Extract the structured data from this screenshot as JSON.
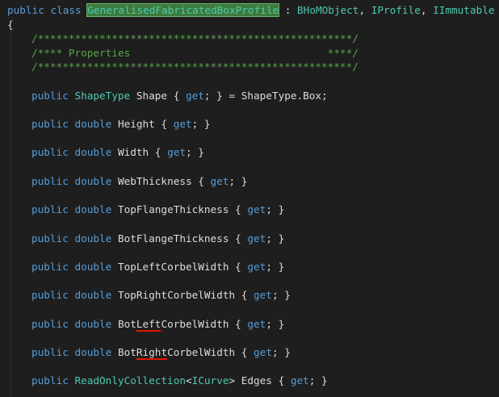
{
  "class_decl": {
    "public": "public",
    "class": "class",
    "name": "GeneralisedFabricatedBoxProfile",
    "colon": " : ",
    "base1": "BHoMObject",
    "comma1": ", ",
    "base2": "IProfile",
    "comma2": ", ",
    "base3": "IImmutable"
  },
  "open_brace": "{",
  "comments": {
    "line1": "/***************************************************/",
    "line2": "/**** Properties                                ****/",
    "line3": "/***************************************************/"
  },
  "properties": [
    {
      "mod": "public",
      "type": "ShapeType",
      "name": " Shape { ",
      "get": "get",
      "tail": "; } = ShapeType.Box;"
    },
    {
      "mod": "public",
      "type": "double",
      "name": " Height { ",
      "get": "get",
      "tail": "; }"
    },
    {
      "mod": "public",
      "type": "double",
      "name": " Width { ",
      "get": "get",
      "tail": "; }"
    },
    {
      "mod": "public",
      "type": "double",
      "name": " WebThickness { ",
      "get": "get",
      "tail": "; }"
    },
    {
      "mod": "public",
      "type": "double",
      "name": " TopFlangeThickness { ",
      "get": "get",
      "tail": "; }"
    },
    {
      "mod": "public",
      "type": "double",
      "name": " BotFlangeThickness { ",
      "get": "get",
      "tail": "; }"
    },
    {
      "mod": "public",
      "type": "double",
      "name": " TopLeftCorbelWidth { ",
      "get": "get",
      "tail": "; }"
    },
    {
      "mod": "public",
      "type": "double",
      "name": " TopRightCorbelWidth { ",
      "get": "get",
      "tail": "; }"
    },
    {
      "mod": "public",
      "type": "double",
      "name_pre": " Bot",
      "name_err": "Left",
      "name_post": "CorbelWidth { ",
      "get": "get",
      "tail": "; }"
    },
    {
      "mod": "public",
      "type": "double",
      "name_pre": " Bot",
      "name_err": "Right",
      "name_post": "CorbelWidth { ",
      "get": "get",
      "tail": "; }"
    },
    {
      "mod": "public",
      "type": "ReadOnlyCollection",
      "generic_open": "<",
      "generic_type": "ICurve",
      "generic_close": ">",
      "name": " Edges { ",
      "get": "get",
      "tail": "; }"
    }
  ],
  "colors": {
    "background": "#1e1e1e",
    "keyword": "#569cd6",
    "type": "#4ec9b0",
    "comment": "#57a64a",
    "text": "#dcdcdc",
    "highlight": "#3d7a3d",
    "error_squiggle": "#e51400"
  }
}
